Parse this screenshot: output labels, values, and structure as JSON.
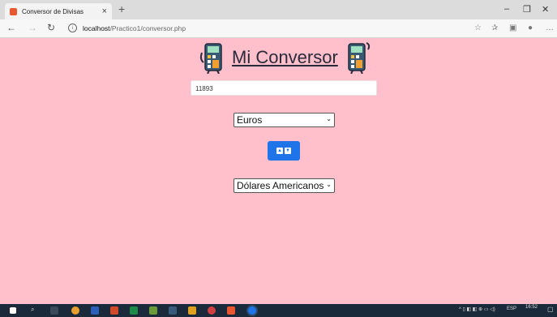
{
  "browser": {
    "tab_title": "Conversor de Divisas",
    "tab_close": "×",
    "new_tab": "+",
    "url_host": "localhost",
    "url_path": "/Practico1/conversor.php"
  },
  "page": {
    "title": "Mi Conversor",
    "amount_value": "11893",
    "from_currency": "Euros",
    "to_currency": "Dólares Americanos"
  },
  "taskbar": {
    "language": "ESP",
    "time": "16:52"
  },
  "colors": {
    "page_background": "#ffc0cb",
    "swap_button": "#1e74e8"
  }
}
